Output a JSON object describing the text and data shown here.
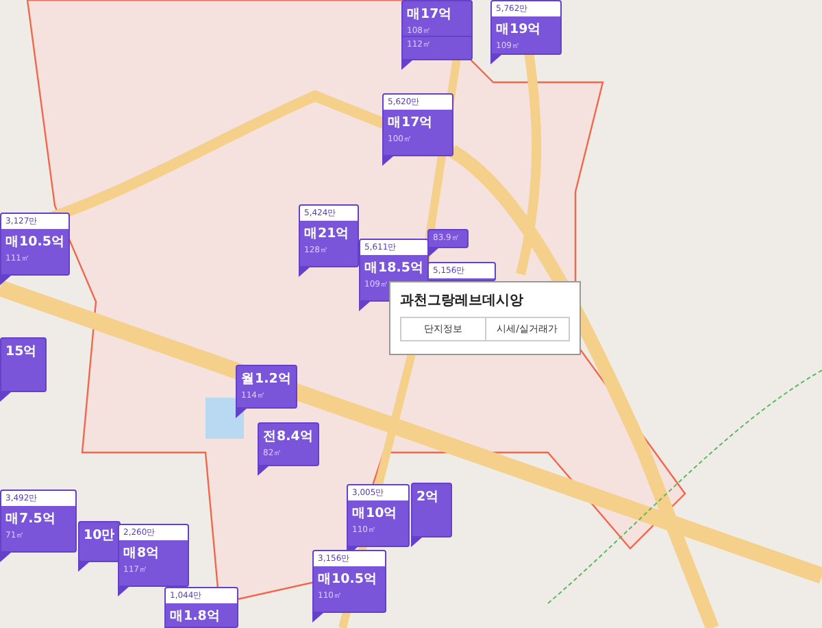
{
  "pins": [
    {
      "price": "매17억",
      "area": "108㎡"
    },
    {
      "area": "112㎡"
    },
    {
      "header": "5,762만",
      "price": "매19억",
      "area": "109㎡"
    },
    {
      "header": "5,620만",
      "price": "매17억",
      "area": "100㎡"
    },
    {
      "header": "3,127만",
      "price": "매10.5억",
      "area": "111㎡"
    },
    {
      "area": "83.9㎡"
    },
    {
      "header": "5,424만",
      "price": "매21억",
      "area": "128㎡"
    },
    {
      "header": "5,611만",
      "price": "매18.5억",
      "area": "109㎡"
    },
    {
      "header": "5,156만"
    },
    {
      "price": "15억"
    },
    {
      "price": "월1.2억",
      "area": "114㎡"
    },
    {
      "price": "전8.4억",
      "area": "82㎡"
    },
    {
      "header": "3,492만",
      "price": "매7.5억",
      "area": "71㎡"
    },
    {
      "price": "10만"
    },
    {
      "header": "2,260만",
      "price": "매8억",
      "area": "117㎡"
    },
    {
      "header": "1,044만",
      "price": "매1.8억"
    },
    {
      "header": "3,005만",
      "price": "매10억",
      "area": "110㎡"
    },
    {
      "price": "2억"
    },
    {
      "header": "3,156만",
      "price": "매10.5억",
      "area": "110㎡"
    }
  ],
  "popup": {
    "title": "과천그랑레브데시앙",
    "buttons": [
      "단지정보",
      "시세/실거래가"
    ]
  }
}
